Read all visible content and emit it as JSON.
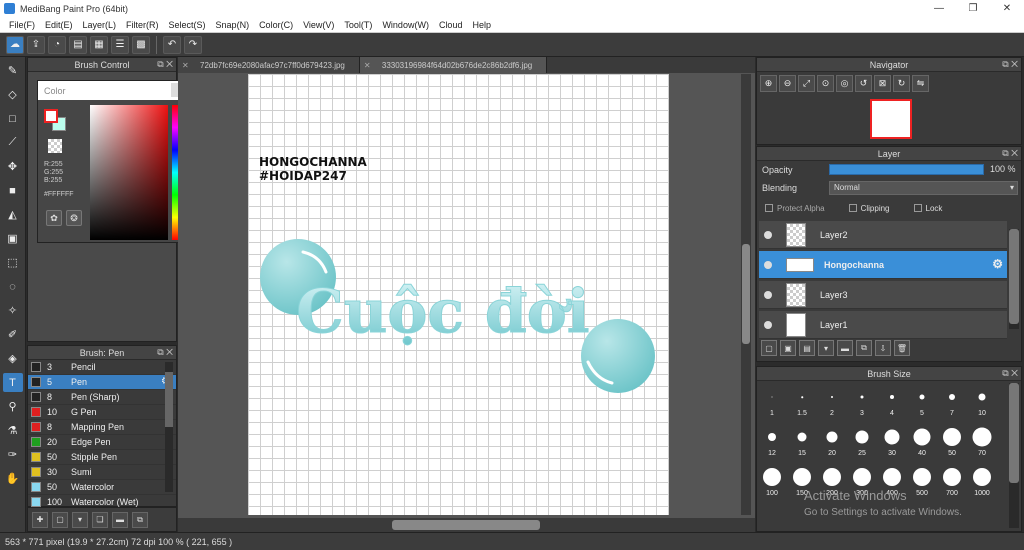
{
  "window": {
    "title": "MediBang Paint Pro (64bit)",
    "minimize": "—",
    "restore": "❐",
    "close": "✕"
  },
  "menu": [
    "File(F)",
    "Edit(E)",
    "Layer(L)",
    "Filter(R)",
    "Select(S)",
    "Snap(N)",
    "Color(C)",
    "View(V)",
    "Tool(T)",
    "Window(W)",
    "Cloud",
    "Help"
  ],
  "panels": {
    "brush_control": "Brush Control",
    "color": "Color",
    "brush_list_title": "Brush: Pen",
    "navigator": "Navigator",
    "layer": "Layer",
    "brush_size": "Brush Size"
  },
  "color": {
    "r": "R:255",
    "g": "G:255",
    "b": "B:255",
    "hex": "#FFFFFF",
    "fg": "#ffffff",
    "accent": "#e22222"
  },
  "tabs": [
    "72db7fc69e2080afac97c7ff0d679423.jpg",
    "33303196984f64d02b676de2c86b2df6.jpg"
  ],
  "canvas_text": {
    "line1": "HONGOCHANNA",
    "line2": "#HOIDAP247",
    "title": "Cuộc đời"
  },
  "brushes": [
    {
      "size": "3",
      "name": "Pencil",
      "color": "#222222"
    },
    {
      "size": "5",
      "name": "Pen",
      "color": "#222222",
      "selected": true
    },
    {
      "size": "8",
      "name": "Pen (Sharp)",
      "color": "#222222"
    },
    {
      "size": "10",
      "name": "G Pen",
      "color": "#e02020"
    },
    {
      "size": "8",
      "name": "Mapping Pen",
      "color": "#e02020"
    },
    {
      "size": "20",
      "name": "Edge Pen",
      "color": "#20a020"
    },
    {
      "size": "50",
      "name": "Stipple Pen",
      "color": "#e0c020"
    },
    {
      "size": "30",
      "name": "Sumi",
      "color": "#e0c020"
    },
    {
      "size": "50",
      "name": "Watercolor",
      "color": "#8ad8f0"
    },
    {
      "size": "100",
      "name": "Watercolor (Wet)",
      "color": "#8ad8f0"
    }
  ],
  "layer_panel": {
    "opacity_label": "Opacity",
    "opacity_value": "100 %",
    "opacity_fraction": 1.0,
    "blending_label": "Blending",
    "blending_value": "Normal",
    "protect_alpha": "Protect Alpha",
    "clipping": "Clipping",
    "lock": "Lock",
    "layers": [
      "Layer2",
      "Hongochanna",
      "Layer3",
      "Layer1"
    ],
    "selected_layer": "Hongochanna"
  },
  "brush_sizes": [
    [
      "1",
      "1.5",
      "2",
      "3",
      "4",
      "5",
      "7",
      "10"
    ],
    [
      "12",
      "15",
      "20",
      "25",
      "30",
      "40",
      "50",
      "70"
    ],
    [
      "100",
      "150",
      "200",
      "300",
      "400",
      "500",
      "700",
      "1000"
    ]
  ],
  "watermark": {
    "line1": "Activate Windows",
    "line2": "Go to Settings to activate Windows."
  },
  "status": "563 * 771 pixel    (19.9 * 27.2cm)    72 dpi    100 %    ( 221, 655 )"
}
